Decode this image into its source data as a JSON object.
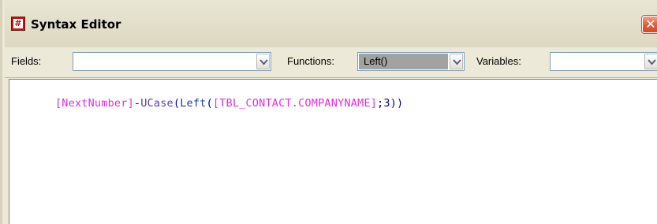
{
  "window": {
    "title": "Syntax Editor",
    "icon_glyph": "#",
    "close_glyph": "✕"
  },
  "toolbar": {
    "fields_label": "Fields:",
    "fields_value": "",
    "functions_label": "Functions:",
    "functions_value": "Left()",
    "variables_label": "Variables:",
    "variables_value": ""
  },
  "editor": {
    "tokens": [
      {
        "text": "[NextNumber]",
        "color": "#e030e0"
      },
      {
        "text": "-",
        "color": "#000080"
      },
      {
        "text": "UCase",
        "color": "#5a3ea8"
      },
      {
        "text": "(",
        "color": "#000080"
      },
      {
        "text": "Left",
        "color": "#1a3aa8"
      },
      {
        "text": "(",
        "color": "#000080"
      },
      {
        "text": "[TBL_CONTACT.COMPANYNAME]",
        "color": "#e030e0"
      },
      {
        "text": ";3))",
        "color": "#000080"
      }
    ]
  },
  "colors": {
    "window_bg": "#ece9d8",
    "field_token": "#e030e0",
    "function_token": "#1a3aa8",
    "operator": "#000080",
    "close_button": "#e0613f",
    "selected_combo": "#a2a2a2"
  }
}
